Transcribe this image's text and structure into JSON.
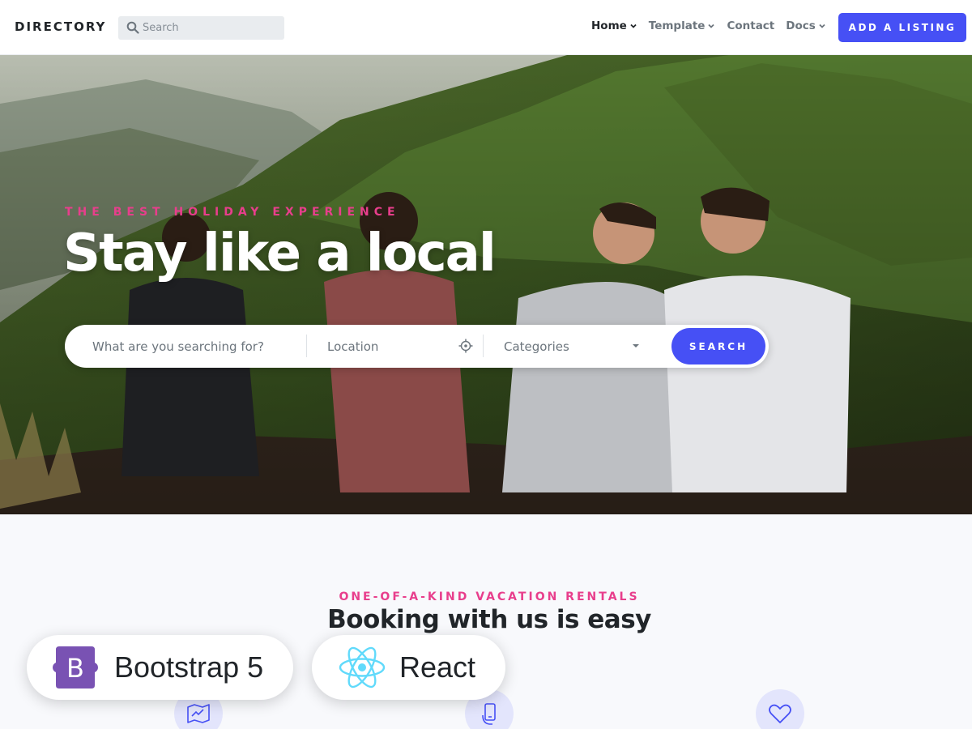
{
  "header": {
    "brand": "DIRECTORY",
    "search_placeholder": "Search",
    "nav": [
      {
        "label": "Home",
        "active": true,
        "dropdown": true
      },
      {
        "label": "Template",
        "active": false,
        "dropdown": true
      },
      {
        "label": "Contact",
        "active": false,
        "dropdown": false
      },
      {
        "label": "Docs",
        "active": false,
        "dropdown": true
      }
    ],
    "cta_label": "ADD A LISTING"
  },
  "hero": {
    "subtitle": "THE BEST HOLIDAY EXPERIENCE",
    "title": "Stay like a local",
    "search": {
      "what_placeholder": "What are you searching for?",
      "location_placeholder": "Location",
      "category_selected": "Categories",
      "button_label": "SEARCH"
    }
  },
  "section": {
    "subtitle": "ONE-OF-A-KIND VACATION RENTALS",
    "title": "Booking with us is easy",
    "features": [
      {
        "icon": "map-icon"
      },
      {
        "icon": "phone-hand-icon"
      },
      {
        "icon": "heart-icon"
      }
    ]
  },
  "badges": [
    {
      "logo": "bootstrap-logo",
      "label": "Bootstrap 5"
    },
    {
      "logo": "react-logo",
      "label": "React"
    }
  ],
  "colors": {
    "primary": "#4650f5",
    "accent": "#e83e8c",
    "bootstrap": "#7952b3",
    "react": "#61dafb"
  }
}
